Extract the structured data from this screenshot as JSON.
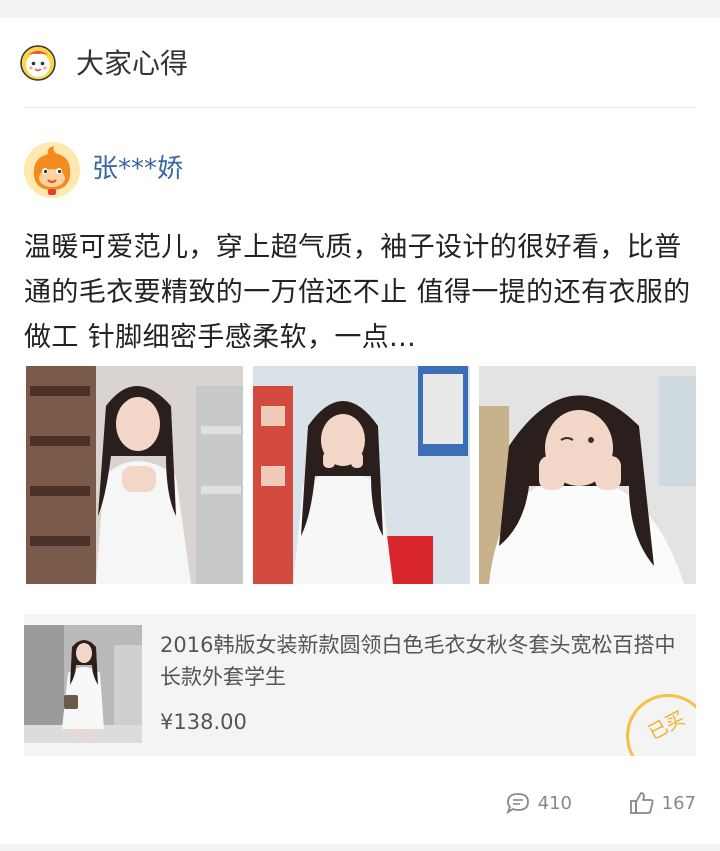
{
  "section": {
    "title": "大家心得",
    "icon": "mascot-logo-icon"
  },
  "review": {
    "username": "张***娇",
    "avatar_icon": "orange-mascot-avatar",
    "text": "温暖可爱范儿，穿上超气质，袖子设计的很好看，比普通的毛衣要精致的一万倍还不止 值得一提的还有衣服的做工 针脚细密手感柔软，一点...",
    "photos": [
      {
        "alt": "买家秀图片1"
      },
      {
        "alt": "买家秀图片2"
      },
      {
        "alt": "买家秀图片3"
      }
    ]
  },
  "product": {
    "title": "2016韩版女装新款圆领白色毛衣女秋冬套头宽松百搭中长款外套学生",
    "price": "¥138.00",
    "badge": "已买"
  },
  "stats": {
    "comments": "410",
    "likes": "167"
  },
  "colors": {
    "username": "#3a66a8",
    "badge": "#f5c043",
    "background": "#f3f3f3"
  }
}
